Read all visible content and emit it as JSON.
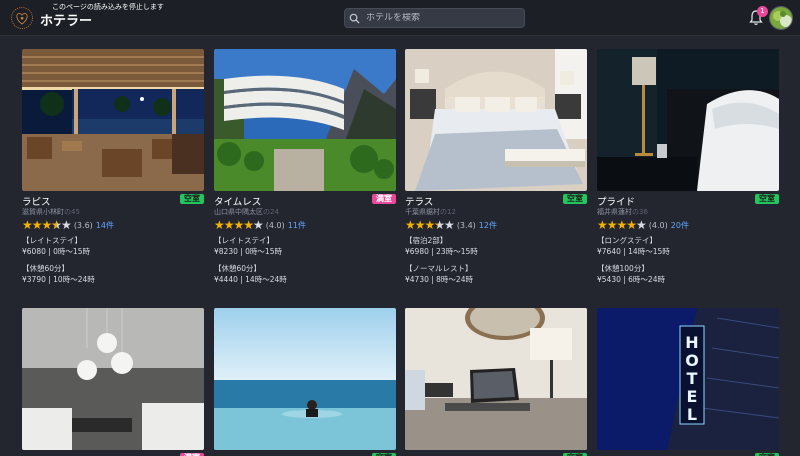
{
  "header": {
    "stop_banner": "このページの読み込みを停止します",
    "title": "ホテラー",
    "search_placeholder": "ホテルを検索",
    "notification_count": "1"
  },
  "colors": {
    "background": "#23262f",
    "header": "#1c1f26",
    "vacant_badge": "#22c55e",
    "full_badge": "#ec4899",
    "star": "#f5b100",
    "link": "#60a5fa"
  },
  "hotels": [
    {
      "name": "ラピス",
      "status": "空室",
      "location": "滋賀県小林町",
      "location_sub": "の45",
      "rating": "(3.6)",
      "stars": 3.6,
      "reviews": "14件",
      "plans": [
        {
          "label": "【レイトステイ】",
          "detail": "¥6080 | 0時〜15時"
        },
        {
          "label": "【休憩60分】",
          "detail": "¥3790 | 10時〜24時"
        }
      ]
    },
    {
      "name": "タイムレス",
      "status": "満室",
      "location": "山口県中隅太区",
      "location_sub": "の24",
      "rating": "(4.0)",
      "stars": 4.0,
      "reviews": "11件",
      "plans": [
        {
          "label": "【レイトステイ】",
          "detail": "¥8230 | 0時〜15時"
        },
        {
          "label": "【休憩60分】",
          "detail": "¥4440 | 14時〜24時"
        }
      ]
    },
    {
      "name": "テラス",
      "status": "空室",
      "location": "千葉県鋸村",
      "location_sub": "の12",
      "rating": "(3.4)",
      "stars": 3.4,
      "reviews": "12件",
      "plans": [
        {
          "label": "【宿泊2部】",
          "detail": "¥6980 | 23時〜15時"
        },
        {
          "label": "【ノーマルレスト】",
          "detail": "¥4730 | 8時〜24時"
        }
      ]
    },
    {
      "name": "プライド",
      "status": "空室",
      "location": "福井県蓮村",
      "location_sub": "の36",
      "rating": "(4.0)",
      "stars": 4.0,
      "reviews": "20件",
      "plans": [
        {
          "label": "【ロングステイ】",
          "detail": "¥7640 | 14時〜15時"
        },
        {
          "label": "【休憩100分】",
          "detail": "¥5430 | 6時〜24時"
        }
      ]
    }
  ],
  "row2_status": [
    "満室",
    "空室",
    "空室",
    "空室"
  ],
  "hotel_sign_text": "HOTEL"
}
